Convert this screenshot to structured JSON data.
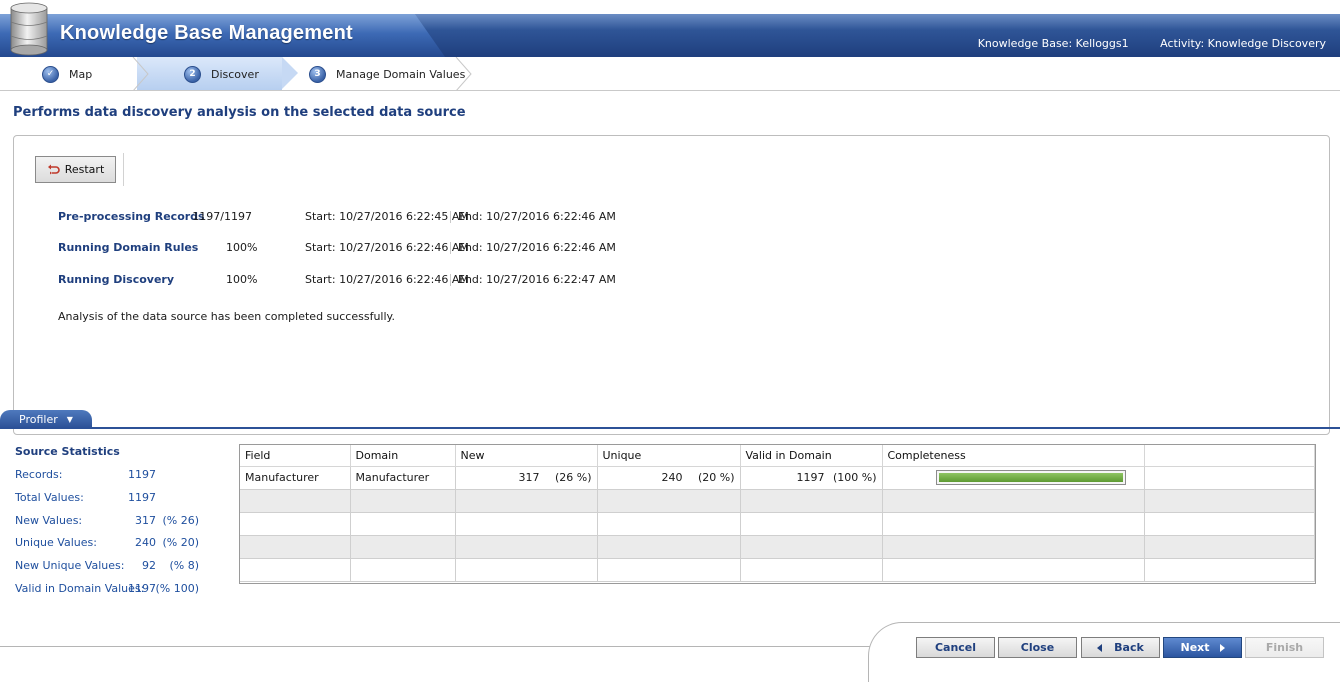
{
  "header": {
    "title": "Knowledge Base Management",
    "knowledge_base": "Knowledge Base: Kelloggs1",
    "activity": "Activity: Knowledge Discovery"
  },
  "steps": [
    {
      "number": "✓",
      "label": "Map",
      "state": "completed"
    },
    {
      "number": "2",
      "label": "Discover",
      "state": "active"
    },
    {
      "number": "3",
      "label": "Manage Domain Values",
      "state": "pending"
    }
  ],
  "page_title": "Performs data discovery analysis on the selected data source",
  "toolbar": {
    "restart_label": "Restart"
  },
  "progress": [
    {
      "label": "Pre-processing Records",
      "value": "1197/1197",
      "start": "Start: 10/27/2016 6:22:45 AM",
      "end": "End: 10/27/2016 6:22:46 AM"
    },
    {
      "label": "Running Domain Rules",
      "value": "100%",
      "start": "Start: 10/27/2016 6:22:46 AM",
      "end": "End: 10/27/2016 6:22:46 AM"
    },
    {
      "label": "Running Discovery",
      "value": "100%",
      "start": "Start: 10/27/2016 6:22:46 AM",
      "end": "End: 10/27/2016 6:22:47 AM"
    }
  ],
  "completion_message": "Analysis of the data source has been completed successfully.",
  "profiler": {
    "tab_label": "Profiler",
    "stats_title": "Source Statistics",
    "stats": [
      {
        "label": "Records:",
        "value": "1197",
        "pct": ""
      },
      {
        "label": "Total Values:",
        "value": "1197",
        "pct": ""
      },
      {
        "label": "New Values:",
        "value": "317",
        "pct": "(26 %)"
      },
      {
        "label": "Unique Values:",
        "value": "240",
        "pct": "(20 %)"
      },
      {
        "label": "New Unique Values:",
        "value": "92",
        "pct": "(8 %)"
      },
      {
        "label": "Valid in Domain Values:",
        "value": "1197",
        "pct": "(100 %)"
      }
    ],
    "grid": {
      "columns": [
        "Field",
        "Domain",
        "New",
        "Unique",
        "Valid in Domain",
        "Completeness"
      ],
      "rows": [
        {
          "field": "Manufacturer",
          "domain": "Manufacturer",
          "new": "317",
          "new_pct": "(26 %)",
          "unique": "240",
          "unique_pct": "(20 %)",
          "valid": "1197",
          "valid_pct": "(100 %)",
          "completeness": 1.0
        }
      ]
    }
  },
  "footer": {
    "cancel": "Cancel",
    "close": "Close",
    "back": "Back",
    "next": "Next",
    "finish": "Finish"
  },
  "colors": {
    "brand_blue": "#2f5597",
    "label_blue": "#1f3f7e",
    "progress_green": "#6aab3c"
  }
}
